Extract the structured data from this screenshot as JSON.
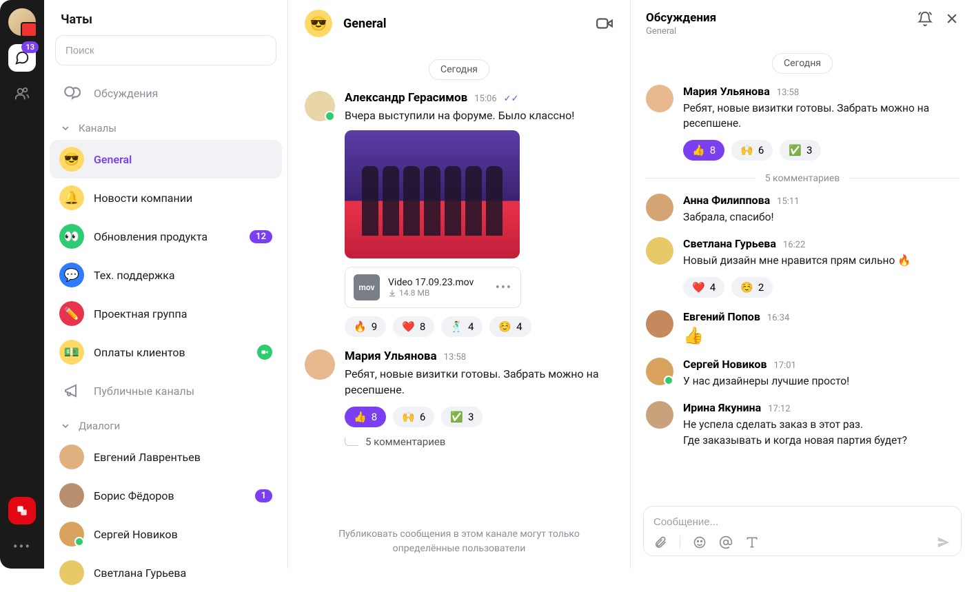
{
  "rail": {
    "chat_badge": "13"
  },
  "sidebar": {
    "title": "Чаты",
    "search_placeholder": "Поиск",
    "discussions": "Обсуждения",
    "channels_label": "Каналы",
    "public_channels": "Публичные каналы",
    "dialogs_label": "Диалоги",
    "channels": [
      {
        "emoji": "😎",
        "label": "General"
      },
      {
        "emoji": "🔔",
        "label": "Новости компании"
      },
      {
        "emoji": "👀",
        "label": "Обновления продукта",
        "badge": "12"
      },
      {
        "emoji": "💬",
        "label": "Тех. поддержка"
      },
      {
        "emoji": "✏️",
        "label": "Проектная группа"
      },
      {
        "emoji": "💵",
        "label": "Оплаты клиентов",
        "video": true
      }
    ],
    "dialogs": [
      {
        "name": "Евгений Лаврентьев"
      },
      {
        "name": "Борис Фёдоров",
        "badge": "1"
      },
      {
        "name": "Сергей Новиков",
        "online": true
      },
      {
        "name": "Светлана Гурьева"
      }
    ]
  },
  "main": {
    "channel_emoji": "😎",
    "channel_name": "General",
    "date_label": "Сегодня",
    "footer": "Публиковать сообщения в этом канале могут только определённые пользователи",
    "messages": [
      {
        "author": "Александр Герасимов",
        "time": "15:06",
        "read": true,
        "text": "Вчера выступили на форуме. Было классно!",
        "file": {
          "name": "Video 17.09.23.mov",
          "size": "14.8 MB",
          "type": "mov"
        },
        "reactions": [
          {
            "emoji": "🔥",
            "count": "9"
          },
          {
            "emoji": "❤️",
            "count": "8"
          },
          {
            "emoji": "🕺",
            "count": "4"
          },
          {
            "emoji": "☺️",
            "count": "4"
          }
        ]
      },
      {
        "author": "Мария Ульянова",
        "time": "13:58",
        "text": "Ребят, новые визитки готовы. Забрать можно на ресепшене.",
        "reactions": [
          {
            "emoji": "👍",
            "count": "8",
            "selected": true
          },
          {
            "emoji": "🙌",
            "count": "6"
          },
          {
            "emoji": "✅",
            "count": "3"
          }
        ],
        "thread": "5 комментариев"
      }
    ]
  },
  "thread": {
    "title": "Обсуждения",
    "subtitle": "General",
    "date_label": "Сегодня",
    "comments_sep": "5 комментариев",
    "composer_placeholder": "Сообщение...",
    "root": {
      "author": "Мария Ульянова",
      "time": "13:58",
      "text": "Ребят, новые визитки готовы. Забрать можно на ресепшене.",
      "reactions": [
        {
          "emoji": "👍",
          "count": "8",
          "selected": true
        },
        {
          "emoji": "🙌",
          "count": "6"
        },
        {
          "emoji": "✅",
          "count": "3"
        }
      ]
    },
    "replies": [
      {
        "author": "Анна Филиппова",
        "time": "15:11",
        "text": "Забрала, спасибо!"
      },
      {
        "author": "Светлана Гурьева",
        "time": "16:22",
        "text": "Новый дизайн мне нравится прям сильно 🔥",
        "reactions": [
          {
            "emoji": "❤️",
            "count": "4"
          },
          {
            "emoji": "☺️",
            "count": "2"
          }
        ]
      },
      {
        "author": "Евгений Попов",
        "time": "16:34",
        "emoji_only": "👍"
      },
      {
        "author": "Сергей Новиков",
        "time": "17:01",
        "text": "У нас дизайнеры лучшие просто!",
        "online": true
      },
      {
        "author": "Ирина Якунина",
        "time": "17:12",
        "text": "Не успела сделать заказ в этот раз.\nГде заказывать и когда новая партия будет?"
      }
    ]
  },
  "avatar_colors": {
    "Александр Герасимов": "#e8d5a8",
    "Мария Ульянова": "#e8b88f",
    "Анна Филиппова": "#d4a574",
    "Светлана Гурьева": "#e8c968",
    "Евгений Попов": "#c48a5e",
    "Сергей Новиков": "#d9a35f",
    "Ирина Якунина": "#c9a17a",
    "Евгений Лаврентьев": "#e0b080",
    "Борис Фёдоров": "#b89070"
  }
}
